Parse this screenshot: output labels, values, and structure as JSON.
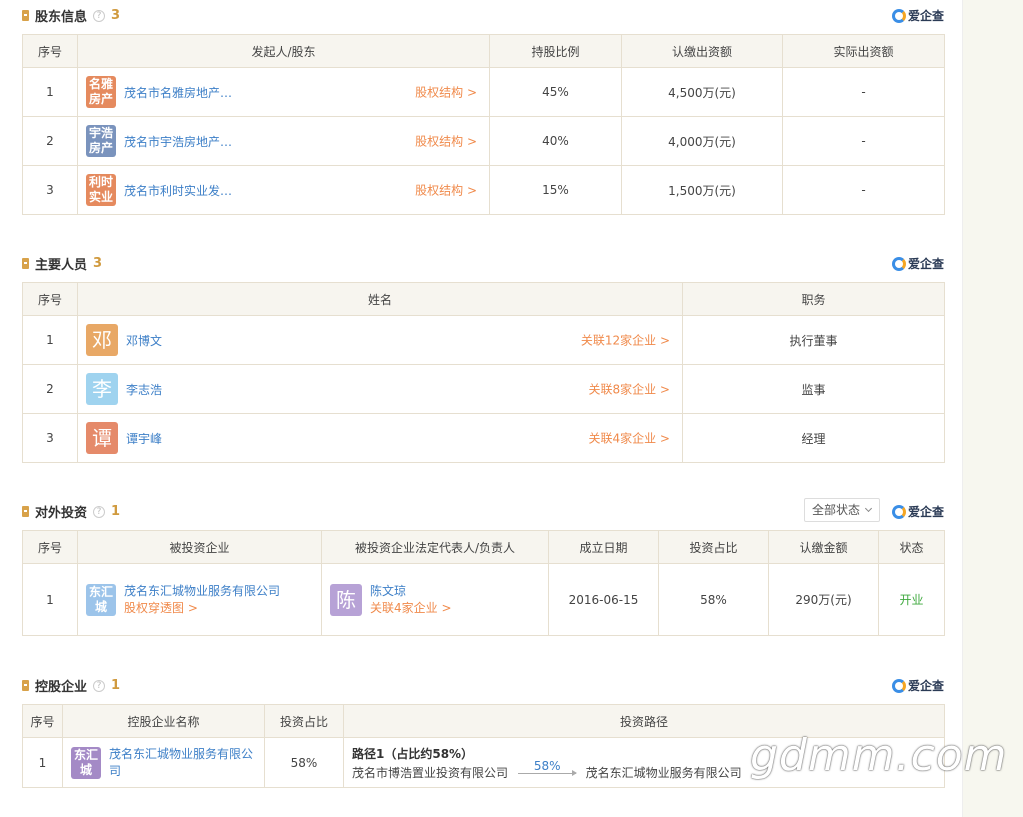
{
  "brand": {
    "label": "爱企查"
  },
  "colors": {
    "accent": "#d8a24a",
    "link": "#3d7fc7",
    "orange": "#f08a4b",
    "green": "#3fa93f"
  },
  "shareholders": {
    "title": "股东信息",
    "count": "3",
    "headers": [
      "序号",
      "发起人/股东",
      "持股比例",
      "认缴出资额",
      "实际出资额"
    ],
    "rows": [
      {
        "no": "1",
        "logo": "名雅房产",
        "logo_color": "#e58a5e",
        "name": "茂名市名雅房地产…",
        "link": "股权结构 >",
        "ratio": "45%",
        "subscribed": "4,500万(元)",
        "actual": "-"
      },
      {
        "no": "2",
        "logo": "宇浩房产",
        "logo_color": "#7a93bd",
        "name": "茂名市宇浩房地产…",
        "link": "股权结构 >",
        "ratio": "40%",
        "subscribed": "4,000万(元)",
        "actual": "-"
      },
      {
        "no": "3",
        "logo": "利时实业",
        "logo_color": "#e58a5e",
        "name": "茂名市利时实业发…",
        "link": "股权结构 >",
        "ratio": "15%",
        "subscribed": "1,500万(元)",
        "actual": "-"
      }
    ]
  },
  "personnel": {
    "title": "主要人员",
    "count": "3",
    "headers": [
      "序号",
      "姓名",
      "职务"
    ],
    "rows": [
      {
        "no": "1",
        "avatar": "邓",
        "avatar_color": "#e8a866",
        "name": "邓博文",
        "link": "关联12家企业 >",
        "role": "执行董事"
      },
      {
        "no": "2",
        "avatar": "李",
        "avatar_color": "#9fd3ef",
        "name": "李志浩",
        "link": "关联8家企业 >",
        "role": "监事"
      },
      {
        "no": "3",
        "avatar": "谭",
        "avatar_color": "#e58a6a",
        "name": "谭宇峰",
        "link": "关联4家企业 >",
        "role": "经理"
      }
    ]
  },
  "investments": {
    "title": "对外投资",
    "count": "1",
    "filter": "全部状态",
    "headers": [
      "序号",
      "被投资企业",
      "被投资企业法定代表人/负责人",
      "成立日期",
      "投资占比",
      "认缴金额",
      "状态"
    ],
    "rows": [
      {
        "no": "1",
        "logo": "东汇城",
        "logo_color": "#9cc4ea",
        "name": "茂名东汇城物业服务有限公司",
        "sublink": "股权穿透图 >",
        "rep_avatar": "陈",
        "rep_color": "#b7a2d6",
        "rep_name": "陈文琼",
        "rep_link": "关联4家企业 >",
        "date": "2016-06-15",
        "ratio": "58%",
        "amount": "290万(元)",
        "status": "开业"
      }
    ]
  },
  "holdings": {
    "title": "控股企业",
    "count": "1",
    "headers": [
      "序号",
      "控股企业名称",
      "投资占比",
      "投资路径"
    ],
    "rows": [
      {
        "no": "1",
        "logo": "东汇城",
        "logo_color": "#a48ac6",
        "name": "茂名东汇城物业服务有限公司",
        "ratio": "58%",
        "path_title": "路径1（占比约58%）",
        "path_from": "茂名市博浩置业投资有限公司",
        "path_pct": "58%",
        "path_to": "茂名东汇城物业服务有限公司"
      }
    ]
  },
  "watermark": "gdmm.com"
}
